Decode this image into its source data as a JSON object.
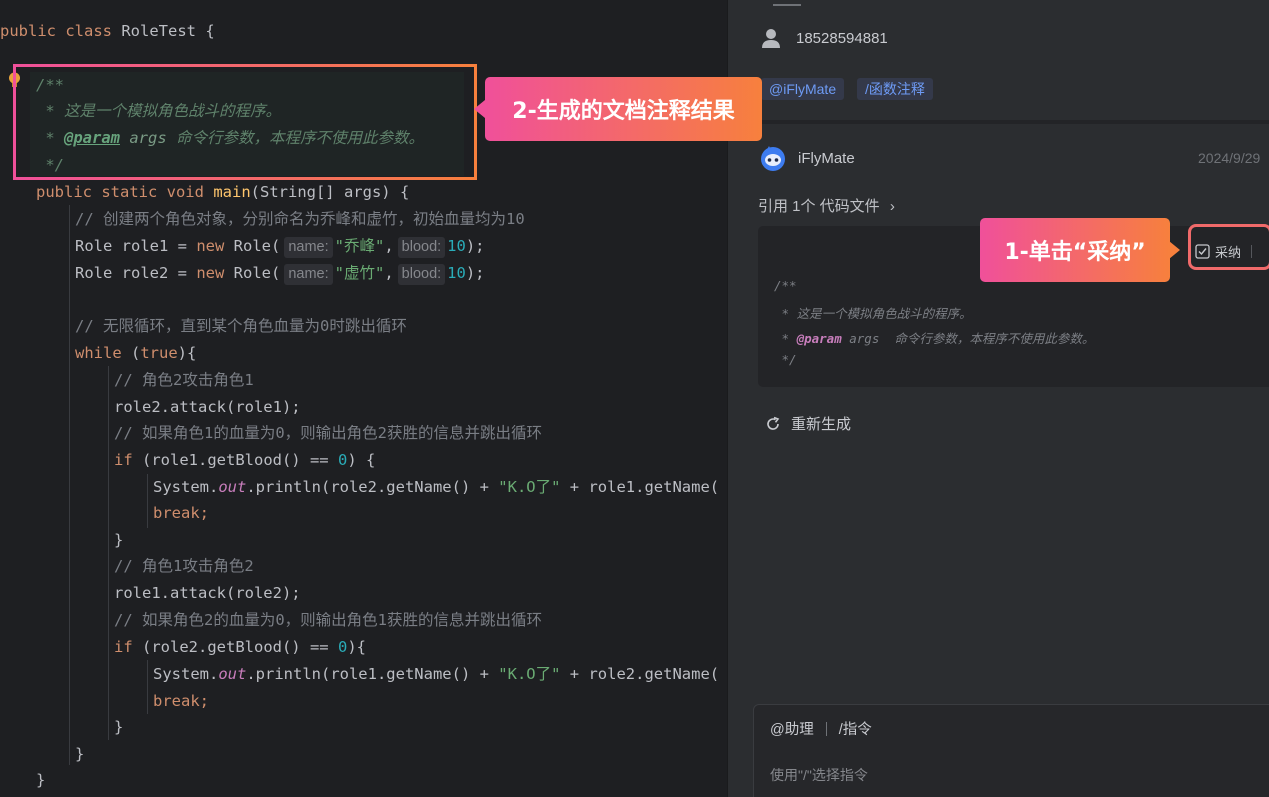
{
  "editor": {
    "class_decl": {
      "kw": "public class",
      "name": "RoleTest",
      "brace": " {"
    },
    "javadoc": {
      "open": "/**",
      "line1": " * 这是一个模拟角色战斗的程序。",
      "line2_prefix": " * ",
      "line2_tag": "@param",
      "line2_name": " args",
      "line2_text": " 命令行参数，本程序不使用此参数。",
      "close": " */"
    },
    "main_sig": {
      "kw": "public static void",
      "name": "main",
      "rest": "(String[] args) {"
    },
    "comment_create": "// 创建两个角色对象，分别命名为乔峰和虚竹，初始血量均为10",
    "role1": {
      "pre": "Role role1 = ",
      "kw": "new",
      "cls": " Role(",
      "hint_name": "name:",
      "name": "\"乔峰\"",
      "comma": ",",
      "hint_blood": "blood:",
      "blood": "10",
      "end": ");"
    },
    "role2": {
      "pre": "Role role2 = ",
      "kw": "new",
      "cls": " Role(",
      "hint_name": "name:",
      "name": "\"虚竹\"",
      "comma": ",",
      "hint_blood": "blood:",
      "blood": "10",
      "end": ");"
    },
    "comment_loop": "// 无限循环，直到某个角色血量为0时跳出循环",
    "while_line": {
      "kw": "while",
      "sp": " (",
      "kw2": "true",
      "end": "){"
    },
    "comment_r2a": "// 角色2攻击角色1",
    "attack1": "role2.attack(role1);",
    "comment_if1": "// 如果角色1的血量为0，则输出角色2获胜的信息并跳出循环",
    "if1": {
      "kw": "if",
      "pre": " (role1.getBlood() == ",
      "num": "0",
      "end": ") {"
    },
    "print1": {
      "pre": "System.",
      "out": "out",
      "mid": ".println(role2.getName() + ",
      "str": "\"K.O了\"",
      "post": " + role1.getName("
    },
    "break_kw": "break;",
    "close_brace": "}",
    "comment_r1a": "// 角色1攻击角色2",
    "attack2": "role1.attack(role2);",
    "comment_if2": "// 如果角色2的血量为0，则输出角色1获胜的信息并跳出循环",
    "if2": {
      "kw": "if",
      "pre": " (role2.getBlood() == ",
      "num": "0",
      "end": "){"
    },
    "print2": {
      "pre": "System.",
      "out": "out",
      "mid": ".println(role1.getName() + ",
      "str": "\"K.O了\"",
      "post": " + role2.getName("
    }
  },
  "panel": {
    "phone": "18528594881",
    "tag_assistant": "@iFlyMate",
    "tag_command": "/函数注释",
    "bot_name": "iFlyMate",
    "date": "2024/9/29",
    "reference": "引用 1个 代码文件",
    "adopt_label": "采纳",
    "code": {
      "open": "/**",
      "line1": " * 这是一个模拟角色战斗的程序。",
      "line2_prefix": " * ",
      "line2_tag": "@param",
      "line2_rest": " args  命令行参数，本程序不使用此参数。",
      "close": " */"
    },
    "regenerate": "重新生成",
    "input": {
      "assist": "@助理",
      "command": "/指令",
      "placeholder": "使用\"/\"选择指令"
    }
  },
  "callouts": {
    "step1": "1-单击“采纳”",
    "step2": "2-生成的文档注释结果"
  },
  "colors": {
    "callout_start": "#f0509a",
    "callout_end": "#f7803d",
    "link_blue": "#6e9bf5"
  }
}
